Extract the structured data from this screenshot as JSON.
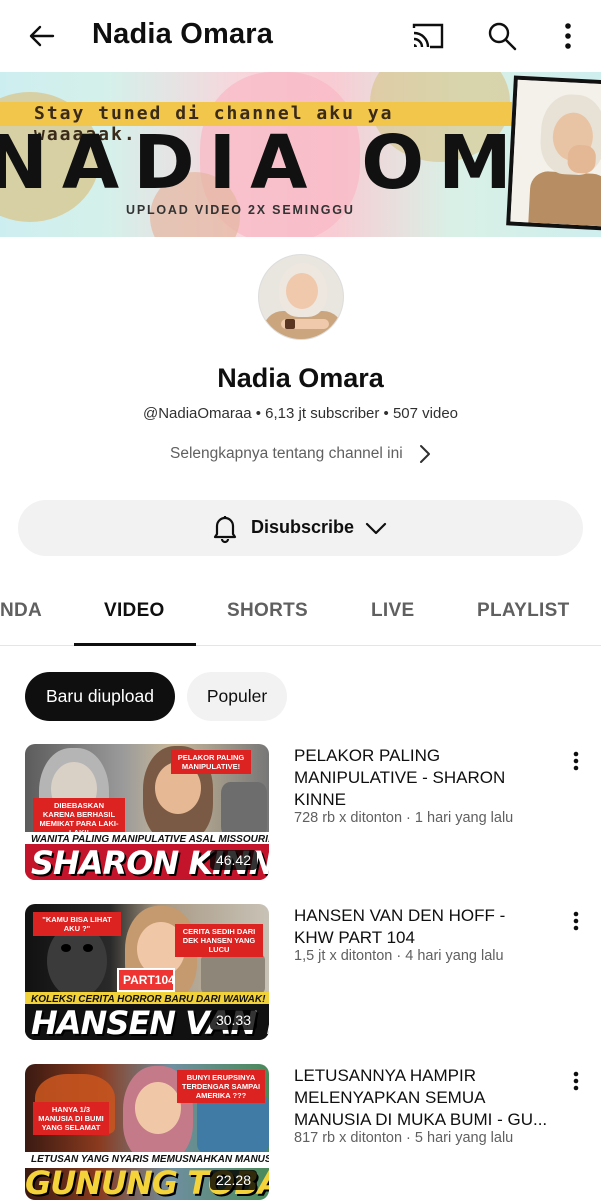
{
  "header": {
    "title": "Nadia Omara"
  },
  "banner": {
    "tagline": "Stay tuned di channel aku ya waaaaak...",
    "name": "NADIA OMARA",
    "schedule": "UPLOAD VIDEO 2X SEMINGGU"
  },
  "channel": {
    "name": "Nadia Omara",
    "meta": "@NadiaOmaraa • 6,13 jt subscriber • 507 video",
    "more_link": "Selengkapnya tentang channel ini",
    "subscribe_label": "Disubscribe"
  },
  "tabs": [
    {
      "label": "NDA"
    },
    {
      "label": "VIDEO",
      "active": true
    },
    {
      "label": "SHORTS"
    },
    {
      "label": "LIVE"
    },
    {
      "label": "PLAYLIST"
    }
  ],
  "chips": [
    {
      "label": "Baru diupload",
      "active": true
    },
    {
      "label": "Populer"
    }
  ],
  "videos": [
    {
      "title": "PELAKOR PALING MANIPULATIVE - SHARON KINNE",
      "meta": "728 rb x ditonton · 1 hari yang lalu",
      "duration": "46.42",
      "thumb_big": "SHARON KINNE",
      "thumb_strip": "WANITA PALING MANIPULATIVE ASAL MISSOURI!",
      "thumb_tag1": "DIBEBASKAN KARENA BERHASIL MEMIKAT PARA LAKI-LAKI!",
      "thumb_tag2": "PELAKOR PALING MANIPULATIVE!"
    },
    {
      "title": "HANSEN VAN DEN HOFF - KHW PART 104",
      "meta": "1,5 jt x ditonton · 4 hari yang lalu",
      "duration": "30.33",
      "thumb_big": "HANSEN VAN DEN HOFF",
      "thumb_strip": "KOLEKSI CERITA HORROR BARU DARI WAWAK!",
      "thumb_tag1": "\"KAMU BISA LIHAT AKU ?\"",
      "thumb_tag2": "CERITA SEDIH DARI DEK HANSEN YANG LUCU",
      "thumb_part": "PART104"
    },
    {
      "title": "LETUSANNYA HAMPIR MELENYAPKAN SEMUA MANUSIA DI MUKA BUMI - GU...",
      "meta": "817 rb x ditonton · 5 hari yang lalu",
      "duration": "22.28",
      "thumb_big": "GUNUNG TOBA",
      "thumb_strip": "LETUSAN YANG NYARIS MEMUSNAHKAN MANUSIA DI MUKA BUMI!",
      "thumb_tag1": "HANYA 1/3 MANUSIA DI BUMI YANG SELAMAT",
      "thumb_tag2": "BUNYI ERUPSINYA TERDENGAR SAMPAI AMERIKA ???"
    }
  ],
  "icons": {
    "back": "arrow-left-icon",
    "cast": "cast-icon",
    "search": "search-icon",
    "more": "more-vert-icon",
    "bell": "bell-icon",
    "chevron": "chevron-down-icon"
  }
}
